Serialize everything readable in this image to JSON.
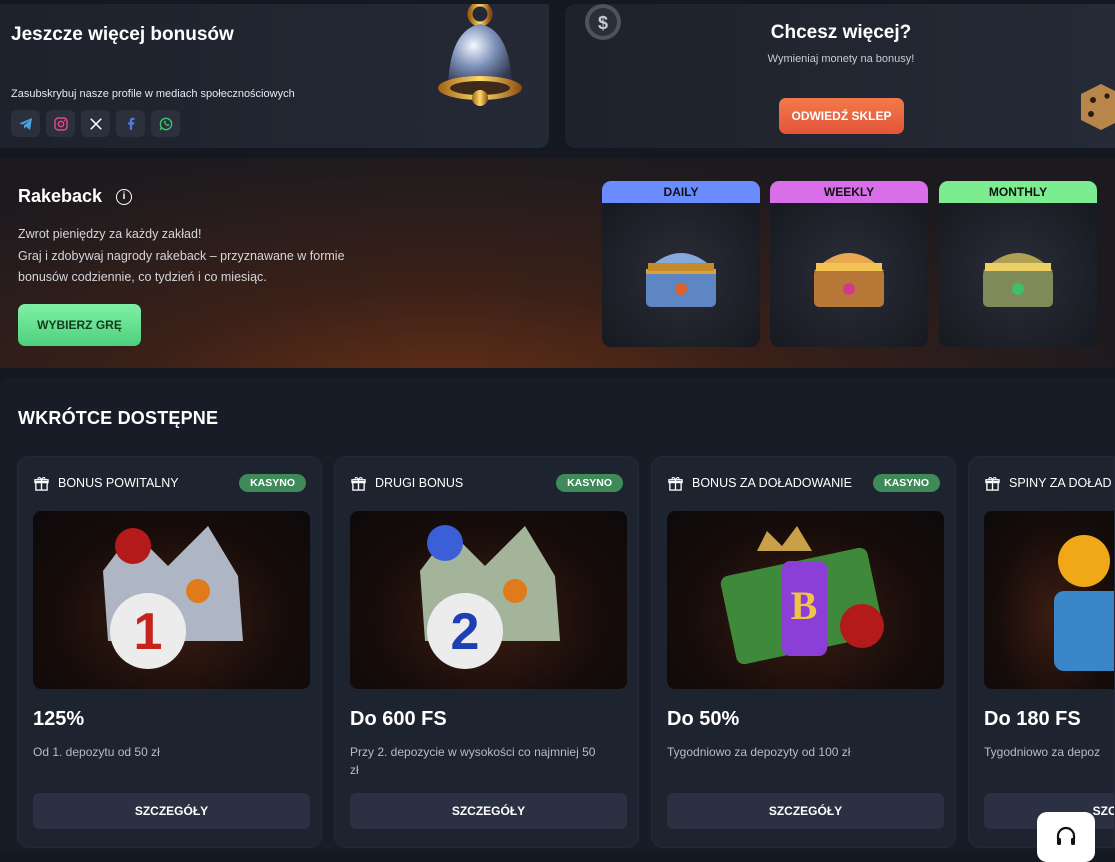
{
  "social_promo": {
    "title": "Jeszcze więcej bonusów",
    "subtitle": "Zasubskrybuj nasze profile w mediach społecznościowych",
    "icons": [
      "telegram-icon",
      "instagram-icon",
      "x-icon",
      "facebook-icon",
      "whatsapp-icon"
    ]
  },
  "shop_promo": {
    "title": "Chcesz więcej?",
    "subtitle": "Wymieniaj monety na bonusy!",
    "button": "ODWIEDŹ SKLEP"
  },
  "rakeback": {
    "title": "Rakeback",
    "line1": "Zwrot pieniędzy za każdy zakład!",
    "line2": "Graj i zdobywaj nagrody rakeback – przyznawane w formie bonusów codziennie, co tydzień i co miesiąc.",
    "button": "WYBIERZ GRĘ",
    "tiers": [
      {
        "label": "DAILY",
        "color": "#6b8cff"
      },
      {
        "label": "WEEKLY",
        "color": "#d86ee8"
      },
      {
        "label": "MONTHLY",
        "color": "#7bec8f"
      }
    ]
  },
  "coming_soon": {
    "title": "WKRÓTCE DOSTĘPNE",
    "cards": [
      {
        "title": "BONUS POWITALNY",
        "badge": "KASYNO",
        "amount": "125%",
        "condition": "Od 1. depozytu od 50 zł",
        "button": "SZCZEGÓŁY"
      },
      {
        "title": "DRUGI BONUS",
        "badge": "KASYNO",
        "amount": "Do 600 FS",
        "condition": "Przy 2. depozycie w wysokości co najmniej 50 zł",
        "button": "SZCZEGÓŁY"
      },
      {
        "title": "BONUS ZA DOŁADOWANIE",
        "badge": "KASYNO",
        "amount": "Do 50%",
        "condition": "Tygodniowo za depozyty od 100 zł",
        "button": "SZCZEGÓŁY"
      },
      {
        "title": "SPINY ZA DOŁAD",
        "badge": "",
        "amount": "Do 180 FS",
        "condition": "Tygodniowo za depoz",
        "button": "SZCZ"
      }
    ]
  }
}
